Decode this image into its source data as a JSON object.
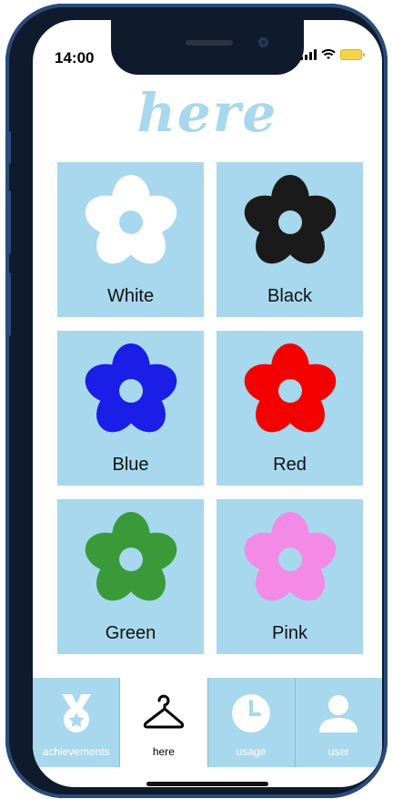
{
  "status_bar": {
    "time": "14:00"
  },
  "header": {
    "title": "here"
  },
  "colors": {
    "accent": "#a7d8ed",
    "title": "#a8d8ee"
  },
  "flowers": [
    {
      "label": "White",
      "color": "#ffffff",
      "icon": "flower-icon"
    },
    {
      "label": "Black",
      "color": "#1a1a1a",
      "icon": "flower-icon"
    },
    {
      "label": "Blue",
      "color": "#1a1ee6",
      "icon": "flower-icon"
    },
    {
      "label": "Red",
      "color": "#f50000",
      "icon": "flower-icon"
    },
    {
      "label": "Green",
      "color": "#3a9a3a",
      "icon": "flower-icon"
    },
    {
      "label": "Pink",
      "color": "#f28ae6",
      "icon": "flower-icon"
    }
  ],
  "tabs": [
    {
      "label": "achievements",
      "icon": "medal-icon",
      "active": false
    },
    {
      "label": "here",
      "icon": "hanger-icon",
      "active": true
    },
    {
      "label": "usage",
      "icon": "clock-icon",
      "active": false
    },
    {
      "label": "user",
      "icon": "user-icon",
      "active": false
    }
  ]
}
